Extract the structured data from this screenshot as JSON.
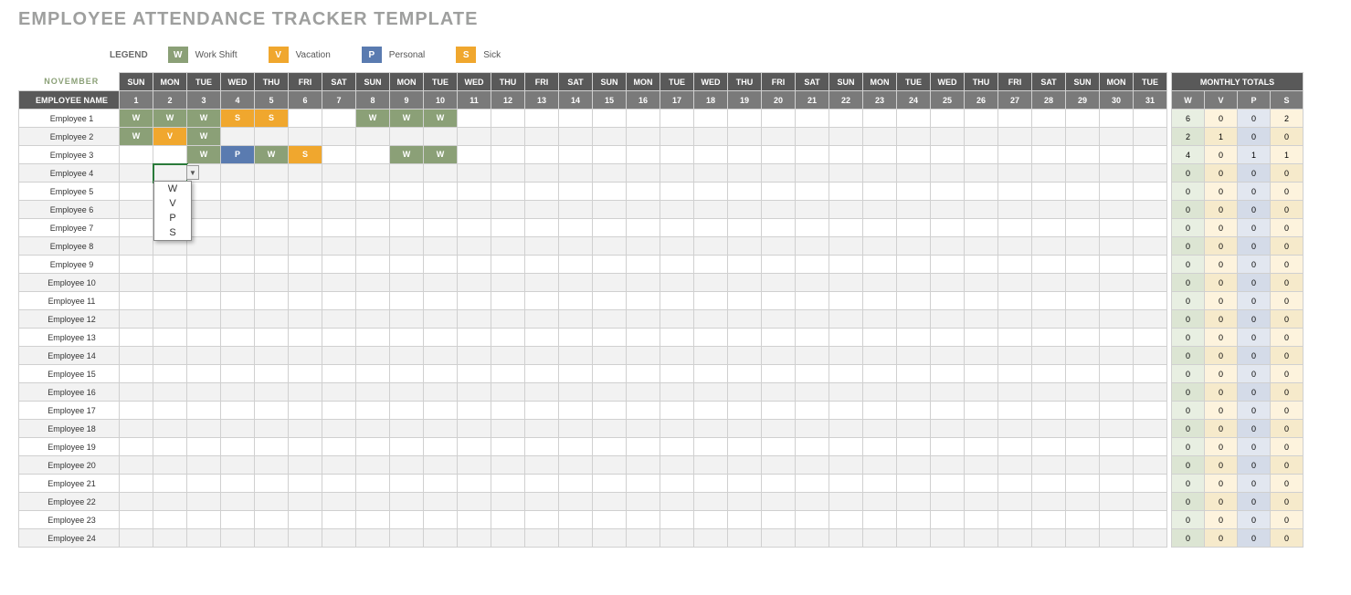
{
  "title": "EMPLOYEE ATTENDANCE TRACKER TEMPLATE",
  "legend": {
    "label": "LEGEND",
    "items": [
      {
        "code": "W",
        "text": "Work Shift",
        "class": "col-W"
      },
      {
        "code": "V",
        "text": "Vacation",
        "class": "col-V"
      },
      {
        "code": "P",
        "text": "Personal",
        "class": "col-P"
      },
      {
        "code": "S",
        "text": "Sick",
        "class": "col-S"
      }
    ]
  },
  "month": "NOVEMBER",
  "dow": [
    "SUN",
    "MON",
    "TUE",
    "WED",
    "THU",
    "FRI",
    "SAT",
    "SUN",
    "MON",
    "TUE",
    "WED",
    "THU",
    "FRI",
    "SAT",
    "SUN",
    "MON",
    "TUE",
    "WED",
    "THU",
    "FRI",
    "SAT",
    "SUN",
    "MON",
    "TUE",
    "WED",
    "THU",
    "FRI",
    "SAT",
    "SUN",
    "MON",
    "TUE"
  ],
  "days": [
    "1",
    "2",
    "3",
    "4",
    "5",
    "6",
    "7",
    "8",
    "9",
    "10",
    "11",
    "12",
    "13",
    "14",
    "15",
    "16",
    "17",
    "18",
    "19",
    "20",
    "21",
    "22",
    "23",
    "24",
    "25",
    "26",
    "27",
    "28",
    "29",
    "30",
    "31"
  ],
  "emp_header": "EMPLOYEE NAME",
  "totals_header": "MONTHLY TOTALS",
  "totals_sub": [
    "W",
    "V",
    "P",
    "S"
  ],
  "dropdown_options": [
    "W",
    "V",
    "P",
    "S"
  ],
  "selected_cell": {
    "row": 3,
    "col": 1
  },
  "employees": [
    {
      "name": "Employee 1",
      "cells": {
        "0": "W",
        "1": "W",
        "2": "W",
        "3": "S",
        "4": "S",
        "7": "W",
        "8": "W",
        "9": "W"
      },
      "totals": [
        "6",
        "0",
        "0",
        "2"
      ]
    },
    {
      "name": "Employee 2",
      "cells": {
        "0": "W",
        "1": "V",
        "2": "W"
      },
      "totals": [
        "2",
        "1",
        "0",
        "0"
      ]
    },
    {
      "name": "Employee 3",
      "cells": {
        "2": "W",
        "3": "P",
        "4": "W",
        "5": "S",
        "8": "W",
        "9": "W"
      },
      "totals": [
        "4",
        "0",
        "1",
        "1"
      ]
    },
    {
      "name": "Employee 4",
      "cells": {},
      "totals": [
        "0",
        "0",
        "0",
        "0"
      ]
    },
    {
      "name": "Employee 5",
      "cells": {},
      "totals": [
        "0",
        "0",
        "0",
        "0"
      ]
    },
    {
      "name": "Employee 6",
      "cells": {},
      "totals": [
        "0",
        "0",
        "0",
        "0"
      ]
    },
    {
      "name": "Employee 7",
      "cells": {},
      "totals": [
        "0",
        "0",
        "0",
        "0"
      ]
    },
    {
      "name": "Employee 8",
      "cells": {},
      "totals": [
        "0",
        "0",
        "0",
        "0"
      ]
    },
    {
      "name": "Employee 9",
      "cells": {},
      "totals": [
        "0",
        "0",
        "0",
        "0"
      ]
    },
    {
      "name": "Employee 10",
      "cells": {},
      "totals": [
        "0",
        "0",
        "0",
        "0"
      ]
    },
    {
      "name": "Employee 11",
      "cells": {},
      "totals": [
        "0",
        "0",
        "0",
        "0"
      ]
    },
    {
      "name": "Employee 12",
      "cells": {},
      "totals": [
        "0",
        "0",
        "0",
        "0"
      ]
    },
    {
      "name": "Employee 13",
      "cells": {},
      "totals": [
        "0",
        "0",
        "0",
        "0"
      ]
    },
    {
      "name": "Employee 14",
      "cells": {},
      "totals": [
        "0",
        "0",
        "0",
        "0"
      ]
    },
    {
      "name": "Employee 15",
      "cells": {},
      "totals": [
        "0",
        "0",
        "0",
        "0"
      ]
    },
    {
      "name": "Employee 16",
      "cells": {},
      "totals": [
        "0",
        "0",
        "0",
        "0"
      ]
    },
    {
      "name": "Employee 17",
      "cells": {},
      "totals": [
        "0",
        "0",
        "0",
        "0"
      ]
    },
    {
      "name": "Employee 18",
      "cells": {},
      "totals": [
        "0",
        "0",
        "0",
        "0"
      ]
    },
    {
      "name": "Employee 19",
      "cells": {},
      "totals": [
        "0",
        "0",
        "0",
        "0"
      ]
    },
    {
      "name": "Employee 20",
      "cells": {},
      "totals": [
        "0",
        "0",
        "0",
        "0"
      ]
    },
    {
      "name": "Employee 21",
      "cells": {},
      "totals": [
        "0",
        "0",
        "0",
        "0"
      ]
    },
    {
      "name": "Employee 22",
      "cells": {},
      "totals": [
        "0",
        "0",
        "0",
        "0"
      ]
    },
    {
      "name": "Employee 23",
      "cells": {},
      "totals": [
        "0",
        "0",
        "0",
        "0"
      ]
    },
    {
      "name": "Employee 24",
      "cells": {},
      "totals": [
        "0",
        "0",
        "0",
        "0"
      ]
    }
  ]
}
